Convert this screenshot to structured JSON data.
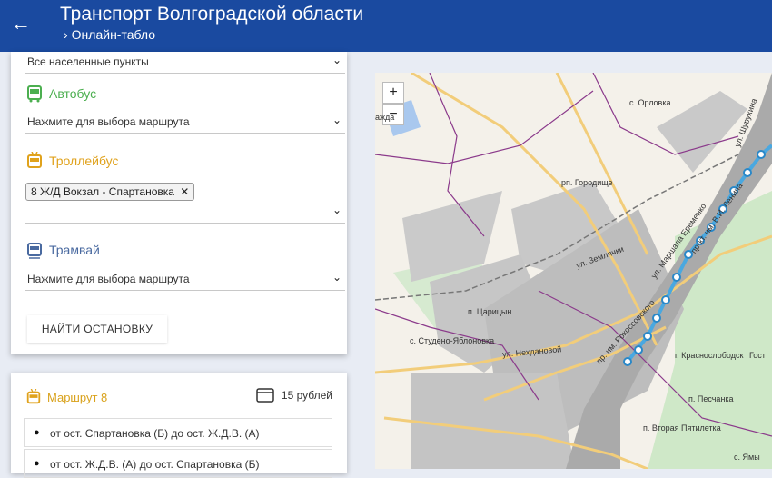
{
  "header": {
    "back_icon": "arrow-left-icon",
    "title": "Транспорт Волгоградской области",
    "subtitle": "Онлайн-табло"
  },
  "filters": {
    "settlement": "Все населенные пункты",
    "bus": {
      "label": "Автобус",
      "placeholder": "Нажмите для выбора маршрута",
      "color": "#4caf50"
    },
    "trolleybus": {
      "label": "Троллейбус",
      "selected_chip": "8 Ж/Д Вокзал - Спартановка",
      "color": "#e0a21c"
    },
    "tram": {
      "label": "Трамвай",
      "placeholder": "Нажмите для выбора маршрута",
      "color": "#4a6aa0"
    },
    "find_button": "НАЙТИ ОСТАНОВКУ"
  },
  "route": {
    "title": "Маршрут 8",
    "price": "15 рублей",
    "directions": [
      "от ост. Спартановка (Б) до ост. Ж.Д.В. (А)",
      "от ост. Ж.Д.В. (А) до ост. Спартановка (Б)"
    ]
  },
  "map": {
    "zoom_in": "+",
    "zoom_out": "−",
    "labels": {
      "zhdanovka": "ажда",
      "orlovka": "с. Орловка",
      "gorodishche": "рп. Городище",
      "caricyn": "п. Царицын",
      "studeno": "с. Студено-Яблоновка",
      "zemlyachki": "ул. Землячки",
      "neglyadnovoy": "ул. Нехдановой",
      "rokossovskogo": "пр. им. Рокоссовского",
      "eremenko": "ул. Маршала Еременко",
      "lenina": "пр-кт. им. В.И. Ленина",
      "shurukhina": "ул. Шурухина",
      "krasnoslobodsk": "г. Краснослободск",
      "pescanka": "п. Песчанка",
      "pyatiletka": "п. Вторая Пятилетка",
      "gost": "Гост",
      "yamy": "с. Ямы"
    }
  }
}
